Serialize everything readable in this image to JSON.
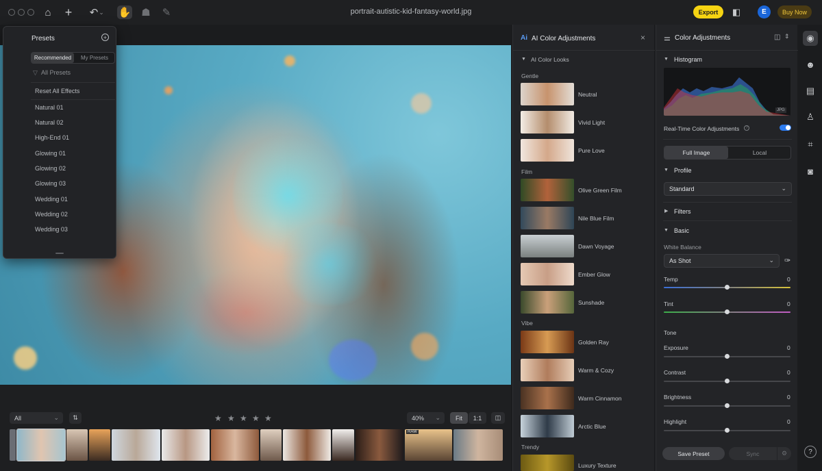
{
  "window": {
    "title": "portrait-autistic-kid-fantasy-world.jpg"
  },
  "toolbar": {
    "export_label": "Export",
    "buy_label": "Buy Now",
    "avatar_letter": "E"
  },
  "presets": {
    "title": "Presets",
    "tabs": [
      "Recommended",
      "My Presets"
    ],
    "filter": "All Presets",
    "reset": "Reset All Effects",
    "items": [
      "Natural 01",
      "Natural 02",
      "High-End 01",
      "Glowing 01",
      "Glowing 02",
      "Glowing 03",
      "Wedding 01",
      "Wedding 02",
      "Wedding 03"
    ]
  },
  "filmstrip": {
    "filter": "All",
    "zoom": "40%",
    "fit": "Fit",
    "one_to_one": "1:1",
    "raw_badge": "RAW"
  },
  "ai_panel": {
    "title": "AI Color Adjustments",
    "section": "AI Color Looks",
    "groups": [
      {
        "name": "Gentle",
        "looks": [
          "Neutral",
          "Vivid Light",
          "Pure Love"
        ]
      },
      {
        "name": "Film",
        "looks": [
          "Olive Green Film",
          "Nile Blue Film",
          "Dawn Voyage",
          "Ember Glow",
          "Sunshade"
        ]
      },
      {
        "name": "Vibe",
        "looks": [
          "Golden Ray",
          "Warm & Cozy",
          "Warm Cinnamon",
          "Arctic Blue"
        ]
      },
      {
        "name": "Trendy",
        "looks": [
          "Luxury Texture"
        ]
      }
    ]
  },
  "color_panel": {
    "title": "Color Adjustments",
    "histogram": "Histogram",
    "jpg_badge": "JPG",
    "realtime": "Real-Time Color Adjustments",
    "scope": [
      "Full Image",
      "Local"
    ],
    "profile": "Profile",
    "profile_value": "Standard",
    "filters": "Filters",
    "basic": "Basic",
    "white_balance": "White Balance",
    "wb_value": "As Shot",
    "temp": {
      "label": "Temp",
      "value": "0"
    },
    "tint": {
      "label": "Tint",
      "value": "0"
    },
    "tone": "Tone",
    "exposure": {
      "label": "Exposure",
      "value": "0"
    },
    "contrast": {
      "label": "Contrast",
      "value": "0"
    },
    "brightness": {
      "label": "Brightness",
      "value": "0"
    },
    "highlight": {
      "label": "Highlight",
      "value": "0"
    },
    "save_preset": "Save Preset",
    "sync": "Sync"
  }
}
